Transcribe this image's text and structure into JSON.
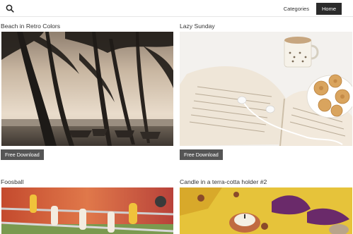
{
  "header": {
    "search_icon": "search-icon",
    "nav": [
      {
        "label": "Categories",
        "active": false
      },
      {
        "label": "Home",
        "active": true
      }
    ]
  },
  "cards": [
    {
      "title": "Beach in Retro Colors",
      "button": "Free Download",
      "image": "silhouetted palm trees and boats on a beach at sunset"
    },
    {
      "title": "Lazy Sunday",
      "button": "Free Download",
      "image": "open book with earphones, coffee cup and plate of cookies"
    },
    {
      "title": "Foosball",
      "button": "",
      "image": "foosball table players close-up"
    },
    {
      "title": "Candle in a terra-cotta holder #2",
      "button": "",
      "image": "candle in terra-cotta holder with dried flowers"
    }
  ],
  "colors": {
    "nav_active_bg": "#2b2b2b",
    "button_bg": "#555555"
  }
}
